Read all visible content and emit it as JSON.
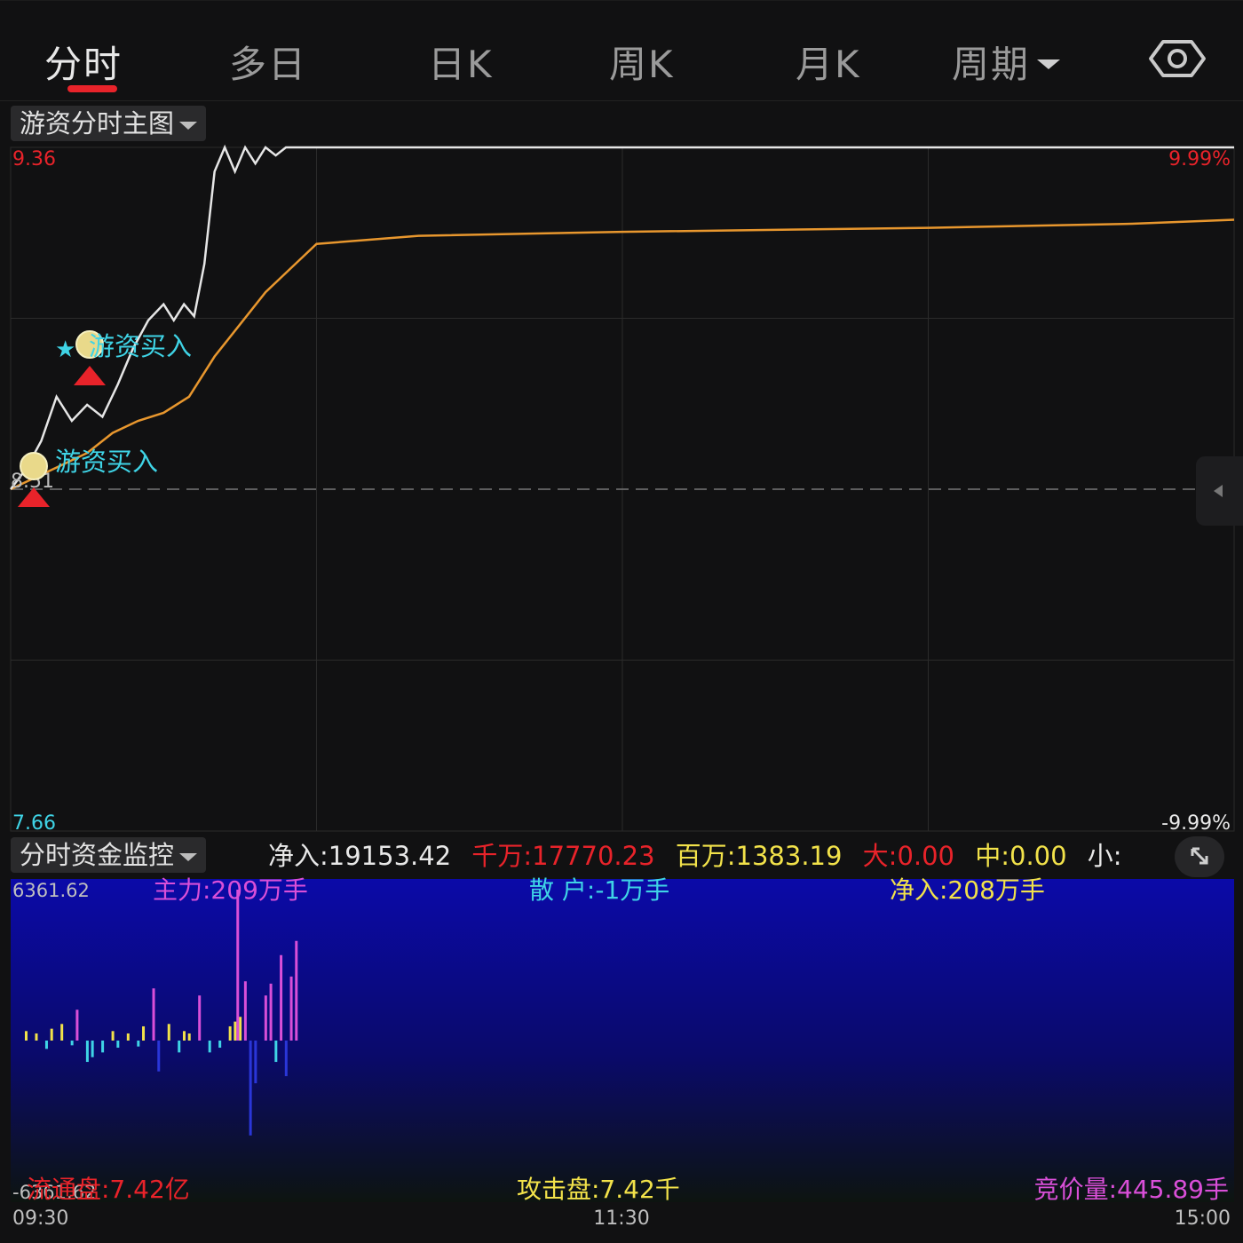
{
  "tabs": [
    {
      "label": "分时",
      "active": true
    },
    {
      "label": "多日"
    },
    {
      "label": "日K"
    },
    {
      "label": "周K"
    },
    {
      "label": "月K"
    },
    {
      "label": "周期"
    }
  ],
  "main_selector": "游资分时主图",
  "fund_selector": "分时资金监控",
  "price_chart": {
    "y_top_label": "9.36",
    "y_bottom_label": "7.66",
    "pct_top_label": "9.99%",
    "pct_bottom_label": "-9.99%",
    "baseline_label": "8.51",
    "annotations": [
      "游资买入",
      "游资买入"
    ]
  },
  "stats": {
    "net_in": "净入:19153.42",
    "qianwan": "千万:17770.23",
    "baiwan": "百万:1383.19",
    "da": "大:0.00",
    "zhong": "中:0.00",
    "xiao": "小:"
  },
  "fund_chart": {
    "y_top_label": "6361.62",
    "y_bottom_label": "-6361.62",
    "zhuli": "主力:209万手",
    "sanhu": "散 户:-1万手",
    "jingru": "净入:208万手",
    "liutongpan": "流通盘:7.42亿",
    "gongjipan": "攻击盘:7.42千",
    "jingjialiang": "竞价量:445.89手"
  },
  "time_axis": [
    "09:30",
    "11:30",
    "15:00"
  ],
  "colors": {
    "up": "#e8232a",
    "price_line": "#e6e6e6",
    "avg_line": "#e8972e",
    "cyan": "#3fd4e6",
    "magenta": "#d94fd8",
    "yellow": "#f2e24a",
    "blue_bar": "#2a36d8"
  },
  "chart_data": [
    {
      "type": "line",
      "ylim": [
        7.66,
        9.36
      ],
      "pct_range": [
        "-9.99%",
        "9.99%"
      ],
      "grid": true,
      "series": [
        {
          "t": [
            0,
            3,
            6,
            9,
            12,
            15,
            18,
            21,
            24,
            27,
            30,
            32,
            34,
            36,
            38,
            40,
            42,
            44,
            46,
            48,
            50,
            52,
            54,
            60,
            240
          ],
          "values": [
            8.51,
            8.56,
            8.63,
            8.74,
            8.68,
            8.72,
            8.69,
            8.77,
            8.86,
            8.93,
            8.97,
            8.93,
            8.97,
            8.94,
            9.07,
            9.3,
            9.36,
            9.3,
            9.36,
            9.32,
            9.36,
            9.34,
            9.36,
            9.36,
            9.36
          ]
        },
        {
          "t": [
            0,
            5,
            10,
            15,
            20,
            25,
            30,
            35,
            40,
            45,
            50,
            55,
            60,
            80,
            120,
            180,
            220,
            240
          ],
          "values": [
            8.51,
            8.54,
            8.57,
            8.6,
            8.65,
            8.68,
            8.7,
            8.74,
            8.84,
            8.92,
            9.0,
            9.06,
            9.12,
            9.14,
            9.15,
            9.16,
            9.17,
            9.18
          ]
        }
      ]
    },
    {
      "type": "bar",
      "ylim": [
        -6361.62,
        6361.62
      ],
      "bars": [
        {
          "t": 2,
          "v": 400,
          "c": "yellow"
        },
        {
          "t": 4,
          "v": 300,
          "c": "yellow"
        },
        {
          "t": 6,
          "v": -350,
          "c": "cyan"
        },
        {
          "t": 7,
          "v": 500,
          "c": "yellow"
        },
        {
          "t": 9,
          "v": 700,
          "c": "yellow"
        },
        {
          "t": 11,
          "v": -200,
          "c": "cyan"
        },
        {
          "t": 12,
          "v": 1300,
          "c": "magenta"
        },
        {
          "t": 14,
          "v": -900,
          "c": "cyan"
        },
        {
          "t": 15,
          "v": -700,
          "c": "cyan"
        },
        {
          "t": 17,
          "v": -500,
          "c": "cyan"
        },
        {
          "t": 19,
          "v": 400,
          "c": "yellow"
        },
        {
          "t": 20,
          "v": -300,
          "c": "cyan"
        },
        {
          "t": 22,
          "v": 300,
          "c": "yellow"
        },
        {
          "t": 24,
          "v": -250,
          "c": "cyan"
        },
        {
          "t": 25,
          "v": 600,
          "c": "yellow"
        },
        {
          "t": 27,
          "v": 2200,
          "c": "magenta"
        },
        {
          "t": 28,
          "v": -1300,
          "c": "blue"
        },
        {
          "t": 30,
          "v": 700,
          "c": "yellow"
        },
        {
          "t": 32,
          "v": -500,
          "c": "cyan"
        },
        {
          "t": 33,
          "v": 400,
          "c": "yellow"
        },
        {
          "t": 34,
          "v": 300,
          "c": "yellow"
        },
        {
          "t": 36,
          "v": 1900,
          "c": "magenta"
        },
        {
          "t": 38,
          "v": -500,
          "c": "cyan"
        },
        {
          "t": 40,
          "v": -300,
          "c": "cyan"
        },
        {
          "t": 42,
          "v": 600,
          "c": "yellow"
        },
        {
          "t": 43,
          "v": 800,
          "c": "yellow"
        },
        {
          "t": 44,
          "v": 1000,
          "c": "yellow"
        },
        {
          "t": 45,
          "v": 2500,
          "c": "magenta"
        },
        {
          "t": 46,
          "v": -4000,
          "c": "blue"
        },
        {
          "t": 47,
          "v": -1800,
          "c": "blue"
        },
        {
          "t": 49,
          "v": 1900,
          "c": "magenta"
        },
        {
          "t": 50,
          "v": 2400,
          "c": "magenta"
        },
        {
          "t": 51,
          "v": -900,
          "c": "cyan"
        },
        {
          "t": 52,
          "v": 3600,
          "c": "magenta"
        },
        {
          "t": 53,
          "v": -1500,
          "c": "blue"
        },
        {
          "t": 54,
          "v": 2700,
          "c": "magenta"
        },
        {
          "t": 55,
          "v": 4200,
          "c": "magenta"
        },
        {
          "t": 43.5,
          "v": 6361.62,
          "c": "magenta"
        }
      ]
    }
  ]
}
